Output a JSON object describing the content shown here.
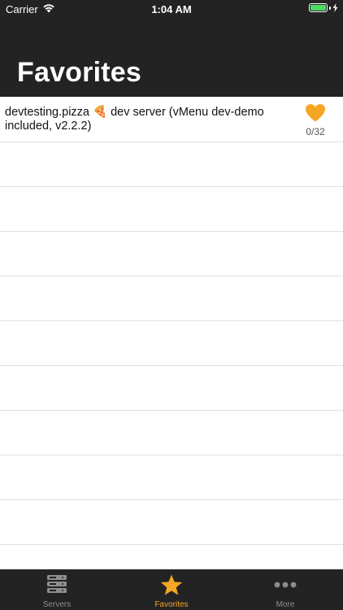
{
  "status_bar": {
    "carrier": "Carrier",
    "time": "1:04 AM",
    "battery_color": "#4cd964"
  },
  "header": {
    "title": "Favorites"
  },
  "list": {
    "items": [
      {
        "name": "devtesting.pizza 🍕 dev server (vMenu dev-demo included, v2.2.2)",
        "players": "0/32",
        "icon": "heart-icon"
      }
    ]
  },
  "tabbar": {
    "accent_color": "#f5a623",
    "tabs": [
      {
        "label": "Servers",
        "icon": "server-rack-icon",
        "active": false
      },
      {
        "label": "Favorites",
        "icon": "star-icon",
        "active": true
      },
      {
        "label": "More",
        "icon": "more-dots-icon",
        "active": false
      }
    ]
  }
}
